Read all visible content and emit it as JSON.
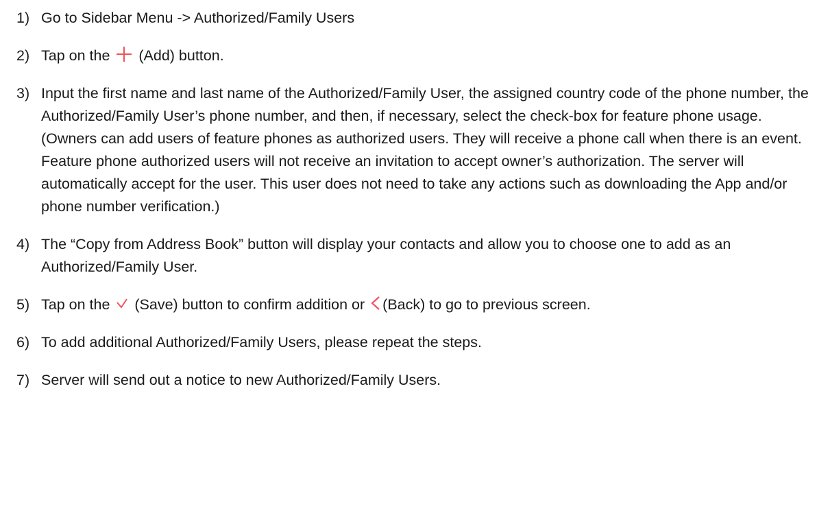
{
  "icons": {
    "add": "plus-icon",
    "save": "checkmark-icon",
    "back": "chevron-left-icon",
    "accent": "#f2545b"
  },
  "steps": [
    {
      "num": "1)",
      "text": "Go to Sidebar Menu -> Authorized/Family Users"
    },
    {
      "num": "2)",
      "before": "Tap on the ",
      "after": " (Add) button."
    },
    {
      "num": "3)",
      "text": "Input the first name and last name of the Authorized/Family User, the assigned country code of the phone number, the Authorized/Family User’s phone number, and then, if necessary, select the check-box for feature phone usage. (Owners can add users of feature phones as authorized users. They will receive a phone call when there is an event. Feature phone authorized users will not receive an invitation to accept owner’s authorization. The server will automatically accept for the user. This user does not need to take any actions such as downloading the App and/or phone number verification.)"
    },
    {
      "num": "4)",
      "text": "The “Copy from Address Book” button will display your contacts and allow you to choose one to add as an Authorized/Family User."
    },
    {
      "num": "5)",
      "before": "Tap on the ",
      "middle": " (Save) button to confirm addition or ",
      "after": "(Back) to go to previous screen."
    },
    {
      "num": "6)",
      "text": "To add additional Authorized/Family Users, please repeat the steps."
    },
    {
      "num": "7)",
      "text": "Server will send out a notice to new Authorized/Family Users."
    }
  ]
}
